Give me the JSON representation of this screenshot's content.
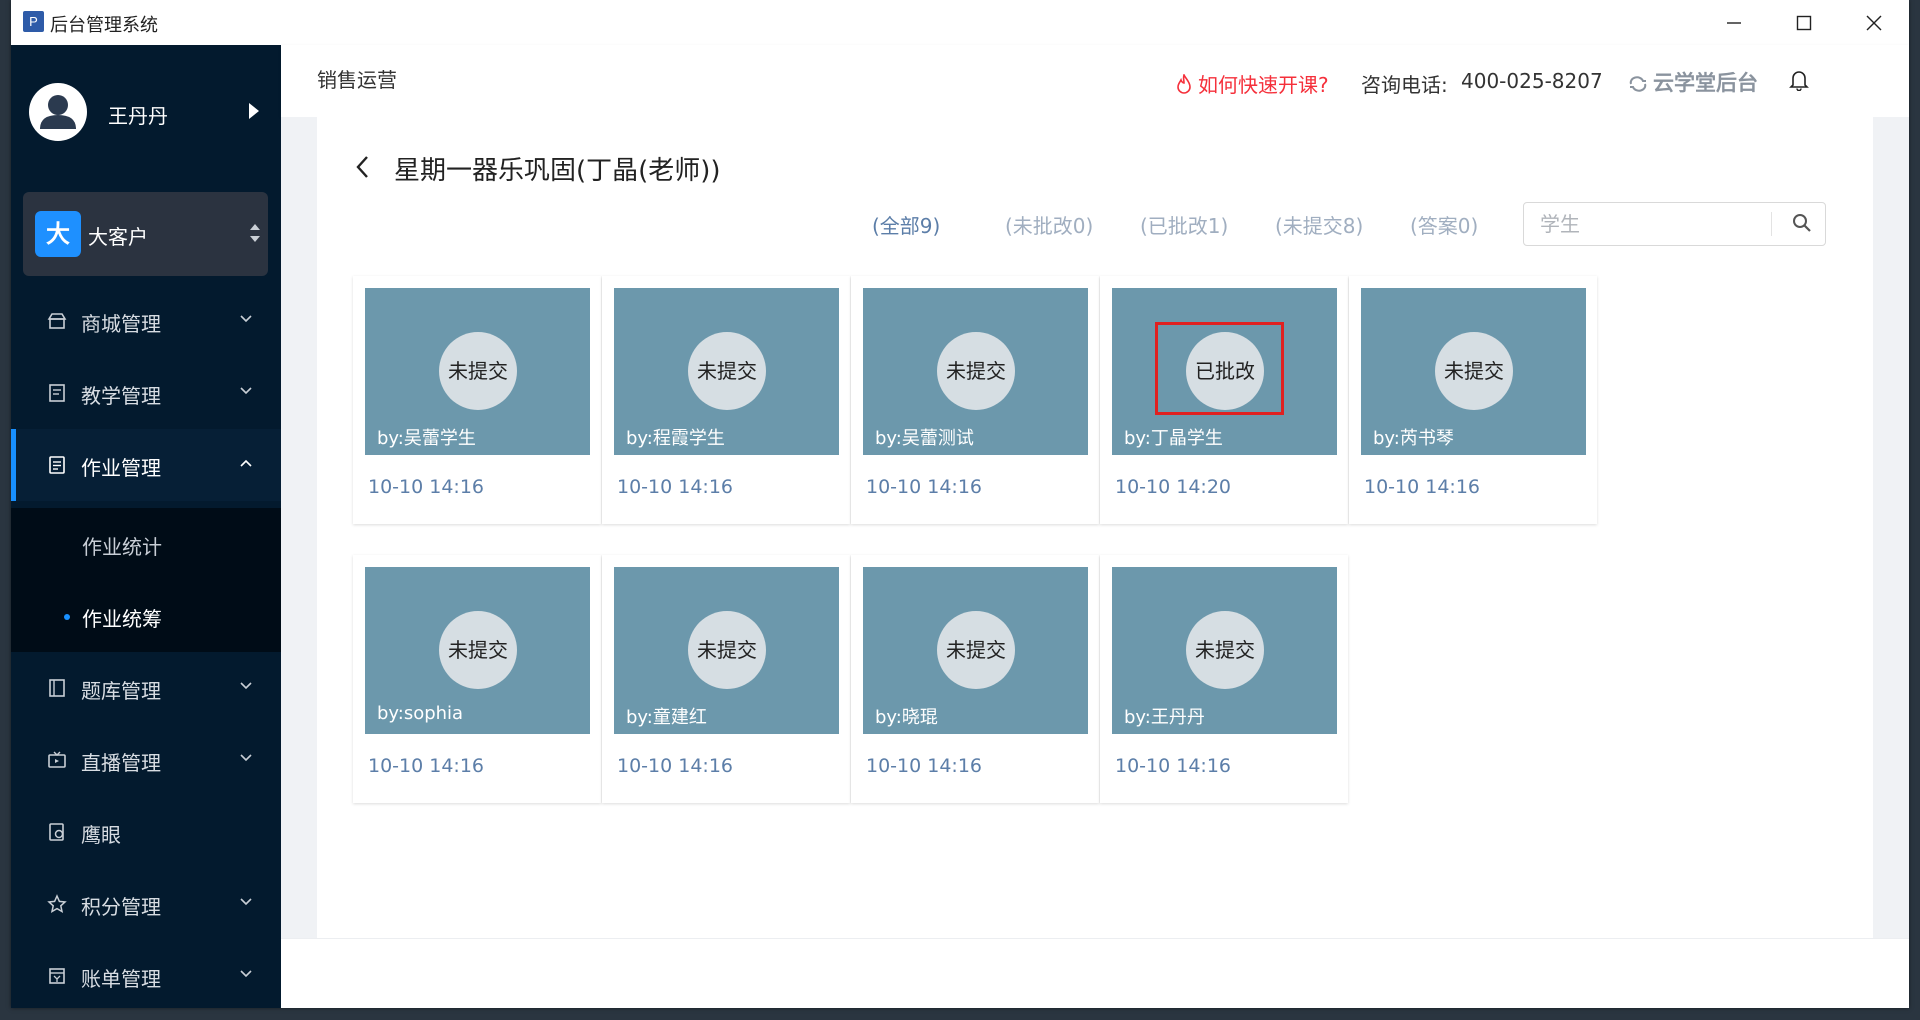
{
  "window": {
    "app_icon_letter": "P",
    "title": "后台管理系统"
  },
  "sidebar": {
    "user_name": "王丹丹",
    "org_badge": "大",
    "org_name": "大客户",
    "items": [
      {
        "label": "商城管理",
        "icon": "shop-icon"
      },
      {
        "label": "教学管理",
        "icon": "book-icon"
      },
      {
        "label": "作业管理",
        "icon": "homework-icon",
        "active": true,
        "expanded": true
      },
      {
        "label": "题库管理",
        "icon": "question-bank-icon"
      },
      {
        "label": "直播管理",
        "icon": "live-icon"
      },
      {
        "label": "鹰眼",
        "icon": "eagle-eye-icon"
      },
      {
        "label": "积分管理",
        "icon": "star-icon"
      },
      {
        "label": "账单管理",
        "icon": "bill-icon"
      }
    ],
    "sub_items": [
      {
        "label": "作业统计",
        "active": false
      },
      {
        "label": "作业统筹",
        "active": true
      }
    ]
  },
  "header": {
    "breadcrumb": "销售运营",
    "help_link": "如何快速开课?",
    "phone_label": "咨询电话:",
    "phone": "400-025-8207",
    "brand": "云学堂后台"
  },
  "page": {
    "title": "星期一器乐巩固(丁晶(老师))",
    "filters": [
      {
        "label": "(全部9)",
        "active": true
      },
      {
        "label": "(未批改0)",
        "active": false
      },
      {
        "label": "(已批改1)",
        "active": false
      },
      {
        "label": "(未提交8)",
        "active": false
      },
      {
        "label": "(答案0)",
        "active": false
      }
    ],
    "search_placeholder": "学生",
    "search_value": ""
  },
  "cards": [
    {
      "status": "未提交",
      "by": "by:吴蕾学生",
      "time": "10-10 14:16"
    },
    {
      "status": "未提交",
      "by": "by:程霞学生",
      "time": "10-10 14:16"
    },
    {
      "status": "未提交",
      "by": "by:吴蕾测试",
      "time": "10-10 14:16"
    },
    {
      "status": "已批改",
      "by": "by:丁晶学生",
      "time": "10-10 14:20",
      "highlighted": true
    },
    {
      "status": "未提交",
      "by": "by:芮书琴",
      "time": "10-10 14:16"
    },
    {
      "status": "未提交",
      "by": "by:sophia",
      "time": "10-10 14:16"
    },
    {
      "status": "未提交",
      "by": "by:童建红",
      "time": "10-10 14:16"
    },
    {
      "status": "未提交",
      "by": "by:晓琨",
      "time": "10-10 14:16"
    },
    {
      "status": "未提交",
      "by": "by:王丹丹",
      "time": "10-10 14:16"
    }
  ],
  "colors": {
    "sidebar_bg": "#031a2e",
    "accent": "#1890ff",
    "thumb": "#6c98ac",
    "help_red": "#f5303b",
    "time_text": "#5c7ea8"
  }
}
